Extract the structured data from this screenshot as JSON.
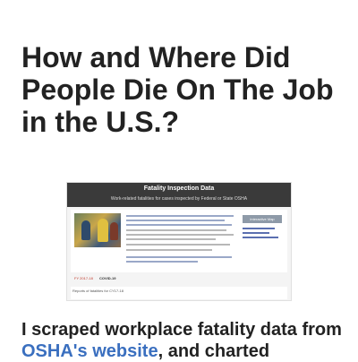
{
  "article": {
    "title": "How and Where Did People Die On The Job in the U.S.?"
  },
  "screenshot": {
    "header_title": "Fatality Inspection Data",
    "header_subtitle": "Work-related fatalities for cases inspected by Federal or State OSHA",
    "button_label": "Interactive Map",
    "tab_a": "FY 2017-18",
    "tab_b": "COVID-19",
    "footer_text": "Reports of fatalities for CY17-18"
  },
  "intro": {
    "text_before": "I scraped workplace fatality data from ",
    "link_text": "OSHA's website",
    "text_after": ", and charted"
  }
}
